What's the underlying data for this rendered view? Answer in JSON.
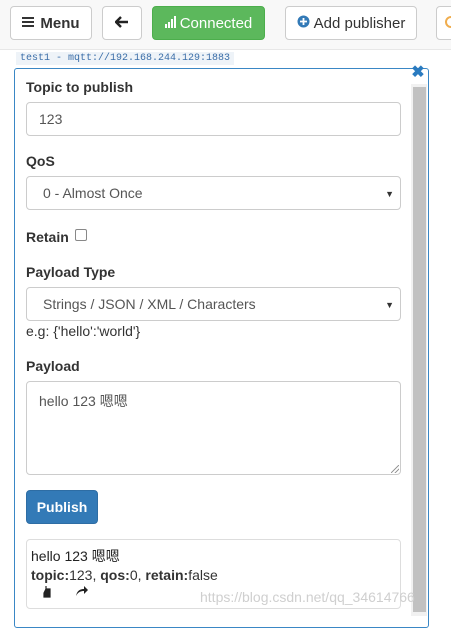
{
  "toolbar": {
    "menu_label": "Menu",
    "connected_label": "Connected",
    "add_publisher_label": "Add publisher"
  },
  "connection_label": "test1 - mqtt://192.168.244.129:1883",
  "form": {
    "topic_label": "Topic to publish",
    "topic_value": "123",
    "qos_label": "QoS",
    "qos_value": "0 - Almost Once",
    "retain_label": "Retain",
    "retain_checked": false,
    "payload_type_label": "Payload Type",
    "payload_type_value": "Strings / JSON / XML / Characters",
    "payload_hint": "e.g: {'hello':'world'}",
    "payload_label": "Payload",
    "payload_value": "hello 123 嗯嗯",
    "publish_label": "Publish"
  },
  "last_message": {
    "payload": "hello 123 嗯嗯",
    "topic_key": "topic:",
    "topic_value": "123",
    "qos_key": "qos:",
    "qos_value": "0",
    "retain_key": "retain:",
    "retain_value": "false"
  },
  "watermark": "https://blog.csdn.net/qq_34614766",
  "colors": {
    "connected": "#5cb85c",
    "primary": "#337ab7",
    "panel_border": "#3a87c5"
  },
  "icons": {
    "menu": "hamburger-icon",
    "back": "arrow-left-icon",
    "signal": "signal-bars-icon",
    "add": "plus-circle-icon",
    "close": "close-icon",
    "repeat": "hand-point-icon",
    "forward": "share-arrow-icon"
  }
}
